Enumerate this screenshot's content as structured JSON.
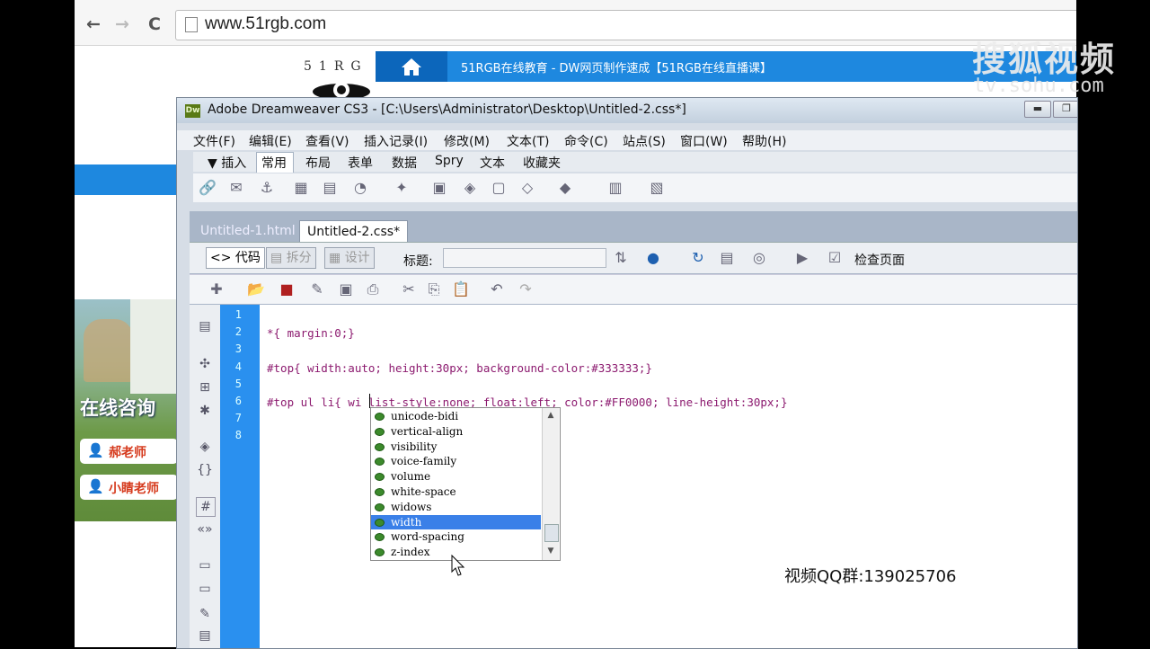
{
  "browser": {
    "url": "www.51rgb.com",
    "nav": {
      "back": "←",
      "forward": "→",
      "reload": "C"
    },
    "logo_text": "51RG",
    "header_title": "51RGB在线教育 - DW网页制作速成【51RGB在线直播课】",
    "home_icon": "home-icon",
    "sidebar": {
      "consult_title": "在线咨询",
      "teachers": [
        "郝老师",
        "小睛老师"
      ]
    }
  },
  "dreamweaver": {
    "title": "Adobe Dreamweaver CS3 - [C:\\Users\\Administrator\\Desktop\\Untitled-2.css*]",
    "icon_text": "Dw",
    "menus": [
      "文件(F)",
      "编辑(E)",
      "查看(V)",
      "插入记录(I)",
      "修改(M)",
      "文本(T)",
      "命令(C)",
      "站点(S)",
      "窗口(W)",
      "帮助(H)"
    ],
    "insert_toggle": "▼ 插入",
    "insert_tabs": [
      "常用",
      "布局",
      "表单",
      "数据",
      "Spry",
      "文本",
      "收藏夹"
    ],
    "insert_selected": "常用",
    "doc_tabs": [
      "Untitled-1.html",
      "Untitled-2.css*"
    ],
    "view_buttons": [
      "代码",
      "拆分",
      "设计"
    ],
    "title_label": "标题:",
    "title_value": "",
    "check_page": "检查页面",
    "line_numbers": [
      "1",
      "2",
      "3",
      "4",
      "5",
      "6",
      "7",
      "8"
    ],
    "code_lines": [
      "",
      "*{ margin:0;}",
      "",
      "#top{ width:auto; height:30px; background-color:#333333;}",
      "",
      "#top ul li{ wi list-style:none; float:left; color:#FF0000; line-height:30px;}",
      "",
      ""
    ],
    "autocomplete": {
      "items": [
        "unicode-bidi",
        "vertical-align",
        "visibility",
        "voice-family",
        "volume",
        "white-space",
        "widows",
        "width",
        "word-spacing",
        "z-index"
      ],
      "selected": "width"
    }
  },
  "overlay": {
    "qq_group": "视频QQ群:139025706",
    "watermark_cn": "搜狐视频",
    "watermark_url": "tv.sohu.com"
  },
  "colors": {
    "browser_accent": "#1e88df",
    "gutter": "#2a90ef",
    "selection": "#3a80e8"
  }
}
